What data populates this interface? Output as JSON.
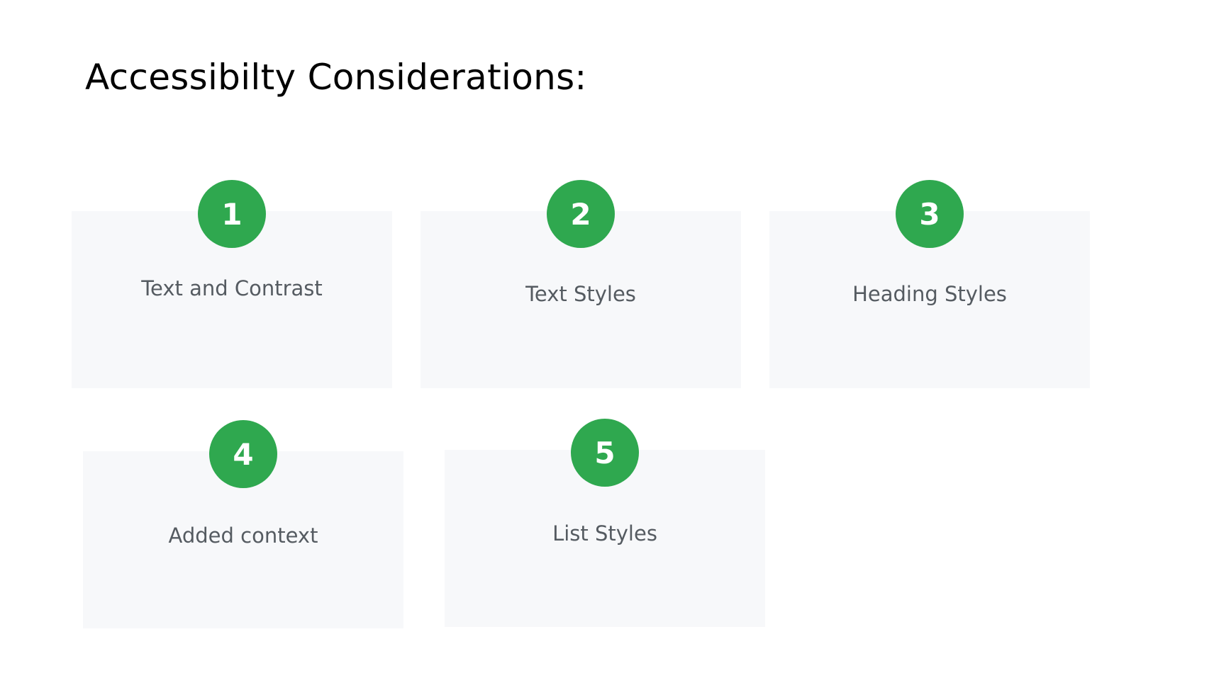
{
  "title": "Accessibilty Considerations:",
  "accent_color": "#2fa84f",
  "card_background": "#f7f8fa",
  "items": [
    {
      "number": "1",
      "label": "Text and Contrast"
    },
    {
      "number": "2",
      "label": "Text Styles"
    },
    {
      "number": "3",
      "label": "Heading Styles"
    },
    {
      "number": "4",
      "label": "Added context"
    },
    {
      "number": "5",
      "label": "List Styles"
    }
  ]
}
